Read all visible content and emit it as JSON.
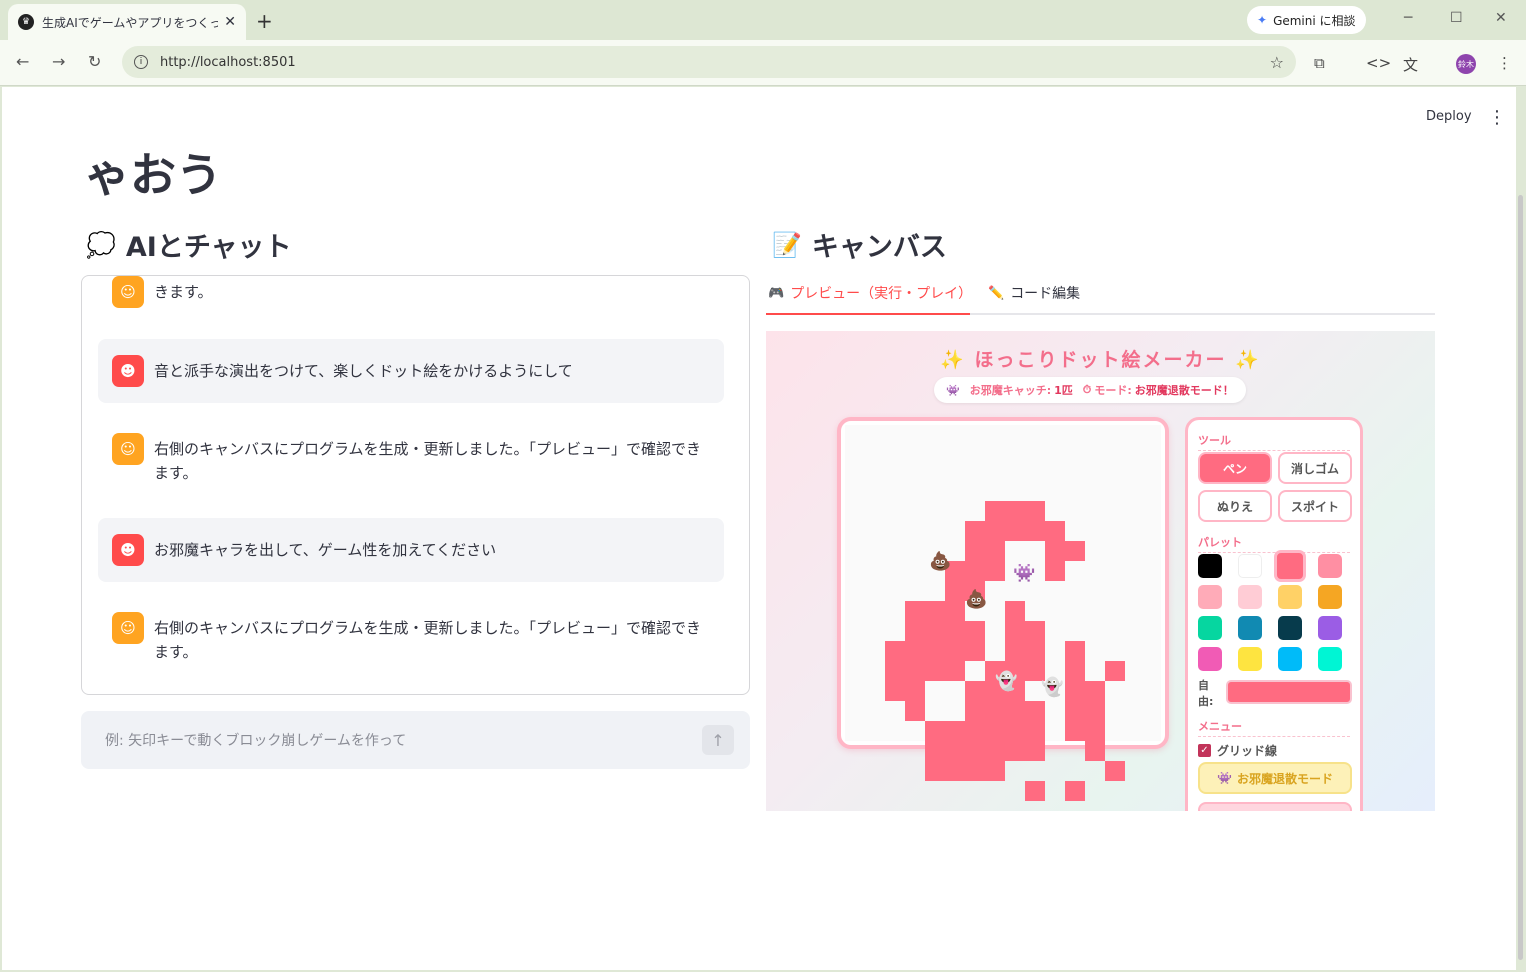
{
  "browser": {
    "tab_title": "生成AIでゲームやアプリをつくっちゃお",
    "url": "http://localhost:8501",
    "gemini_label": "Gemini に相談",
    "avatar_text": "鈴木"
  },
  "app": {
    "deploy_label": "Deploy",
    "page_title": "ゃおう",
    "chat_heading": "AIとチャット",
    "canvas_heading": "キャンバス"
  },
  "chat": {
    "messages": [
      {
        "role": "assistant",
        "text": "きます。"
      },
      {
        "role": "user",
        "text": "音と派手な演出をつけて、楽しくドット絵をかけるようにして"
      },
      {
        "role": "assistant",
        "text": "右側のキャンバスにプログラムを生成・更新しました。「プレビュー」で確認できます。"
      },
      {
        "role": "user",
        "text": "お邪魔キャラを出して、ゲーム性を加えてください"
      },
      {
        "role": "assistant",
        "text": "右側のキャンバスにプログラムを生成・更新しました。「プレビュー」で確認できます。"
      }
    ],
    "input_placeholder": "例: 矢印キーで動くブロック崩しゲームを作って"
  },
  "canvas": {
    "tabs": [
      {
        "label": "プレビュー（実行・プレイ）",
        "active": true
      },
      {
        "label": "コード編集",
        "active": false
      }
    ]
  },
  "game": {
    "title": "✨ ほっこりドット絵メーカー ✨",
    "catch_label": "お邪魔キャッチ:",
    "catch_value": "1匹",
    "mode_label": "モード:",
    "mode_value": "お邪魔退散モード！",
    "tools_heading": "ツール",
    "tools": [
      "ペン",
      "消しゴム",
      "ぬりえ",
      "スポイト"
    ],
    "active_tool": "ペン",
    "palette_heading": "パレット",
    "palette": [
      "#000000",
      "#ffffff",
      "#ff6b81",
      "#ff8fa3",
      "#ffabb8",
      "#ffccd5",
      "#ffd166",
      "#f5a623",
      "#06d6a0",
      "#118ab2",
      "#073b4c",
      "#9b5de5",
      "#f15bb5",
      "#fee440",
      "#00bbf9",
      "#00f5d4"
    ],
    "selected_color": "#ff6b81",
    "free_color_label": "自由:",
    "menu_heading": "メニュー",
    "grid_label": "グリッド線",
    "grid_on": true,
    "mode_button": "お邪魔退散モード"
  }
}
